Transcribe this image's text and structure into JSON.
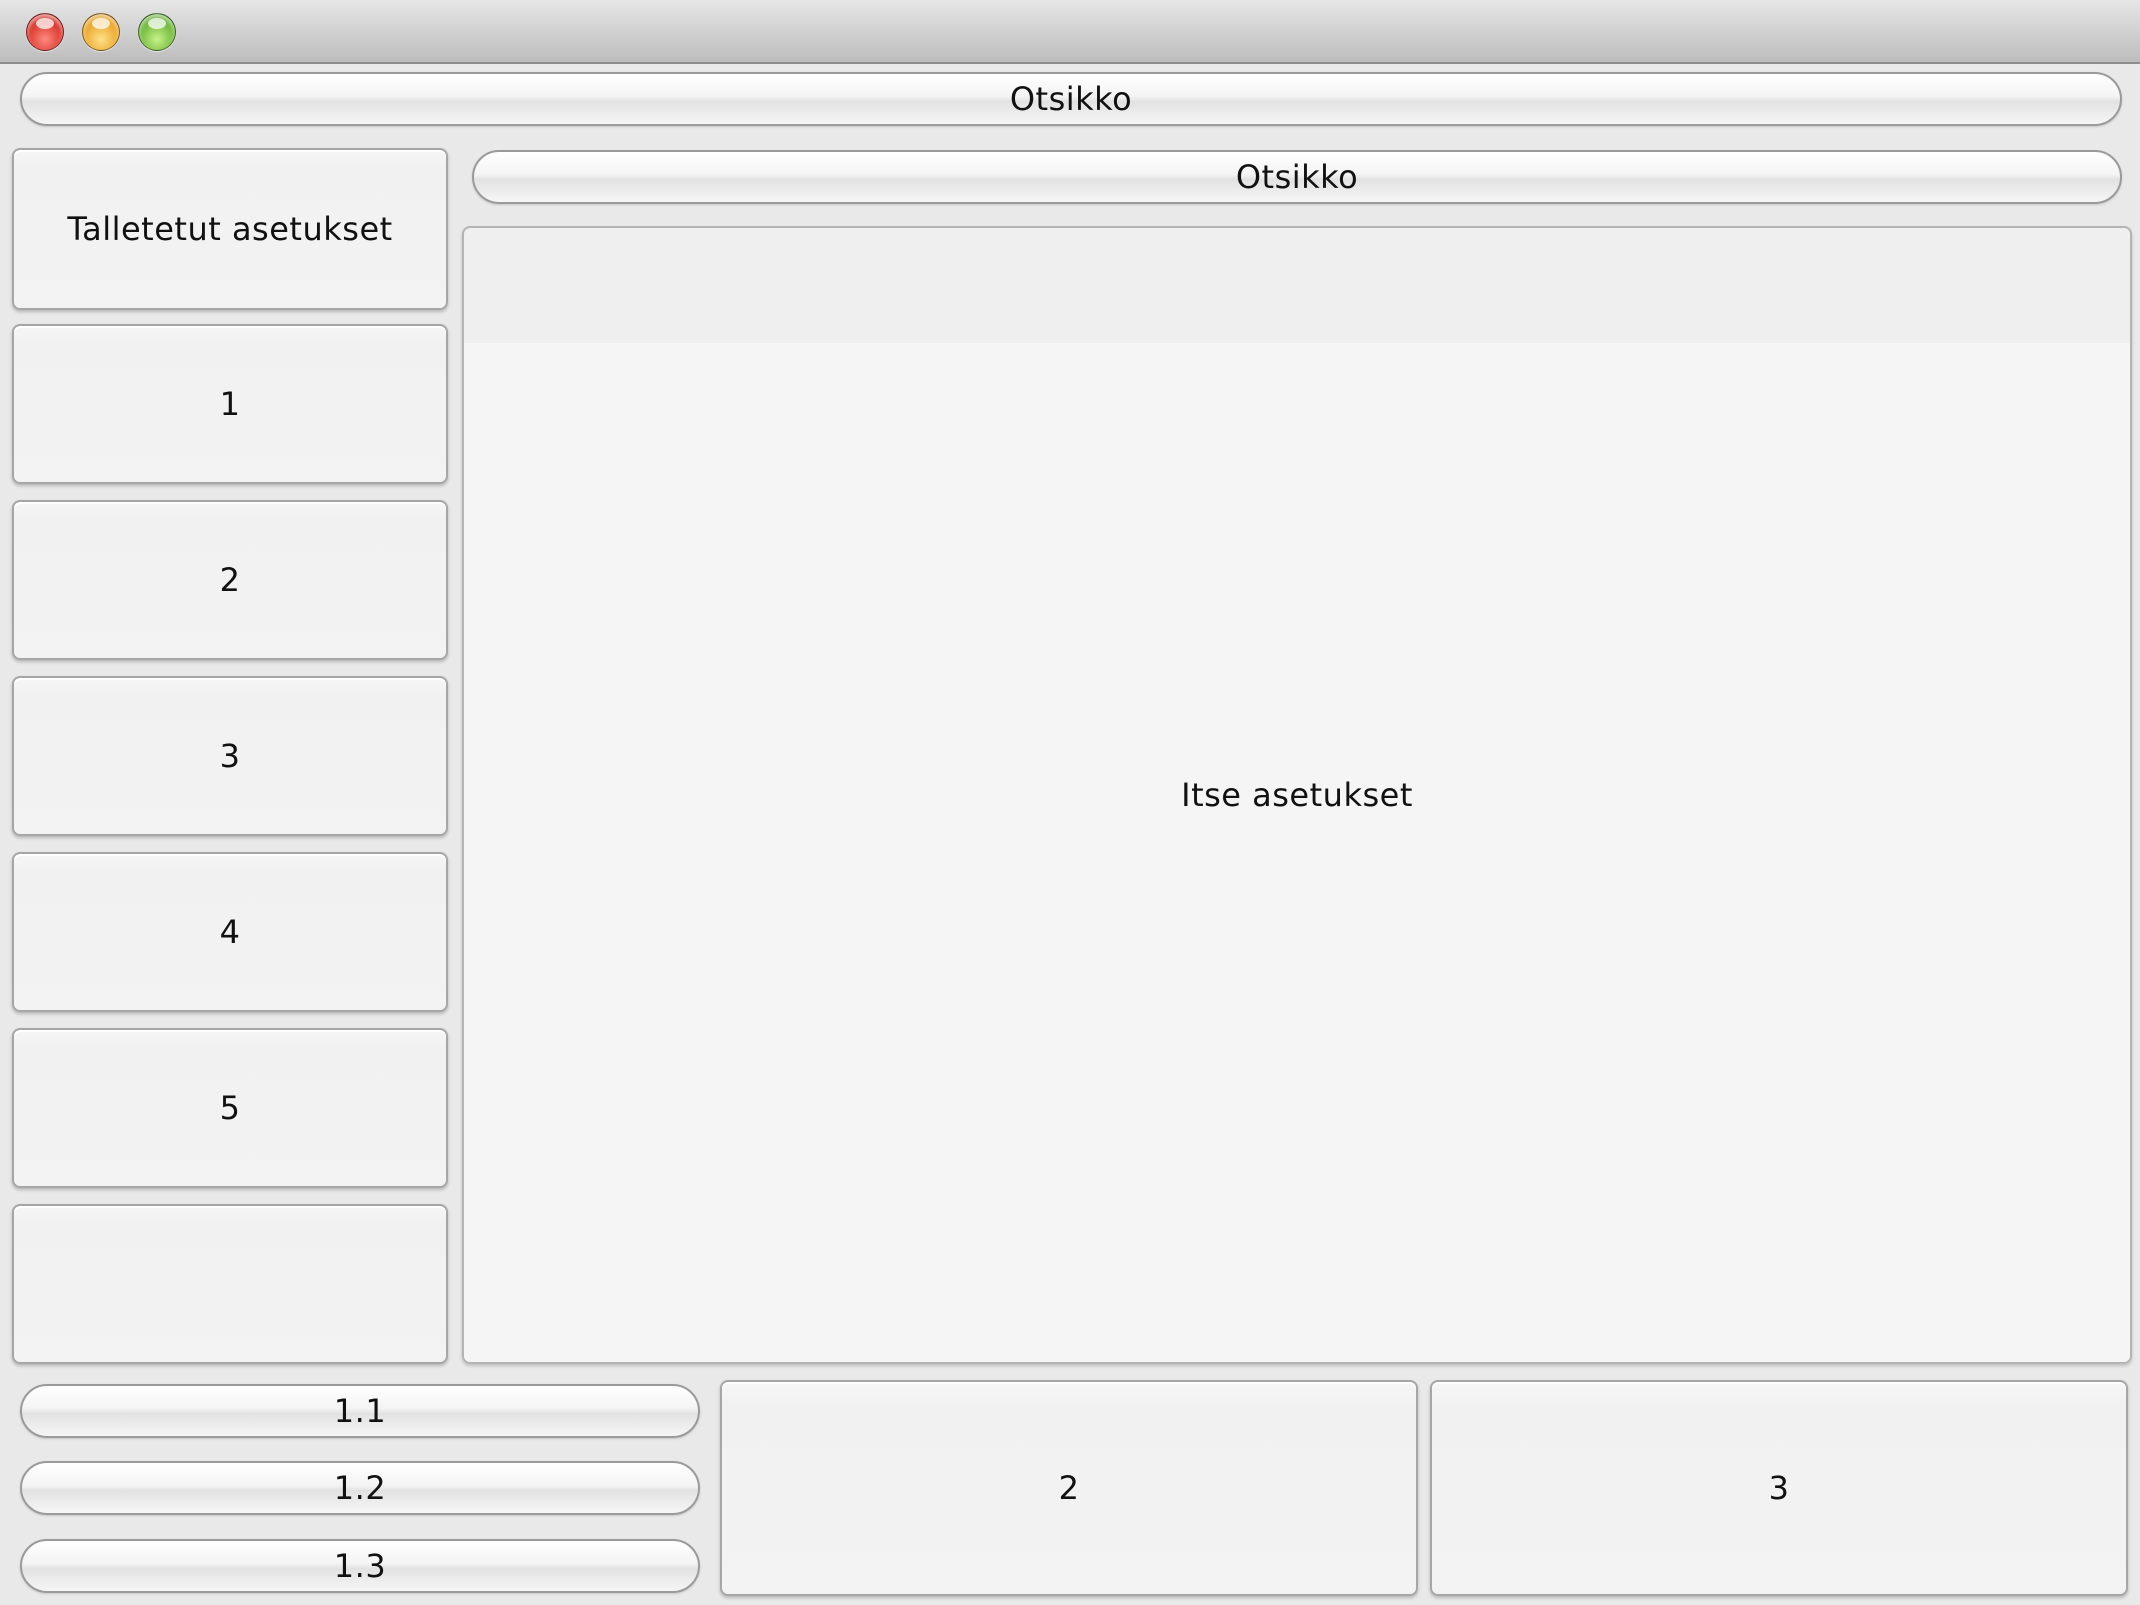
{
  "window": {
    "controls": [
      {
        "name": "close",
        "color": "#d0241b"
      },
      {
        "name": "minimize",
        "color": "#e59a16"
      },
      {
        "name": "zoom",
        "color": "#5cab2a"
      }
    ]
  },
  "header": {
    "top_title": "Otsikko",
    "main_title": "Otsikko"
  },
  "sidebar": {
    "saved_settings_label": "Talletetut asetukset",
    "items": [
      "1",
      "2",
      "3",
      "4",
      "5",
      ""
    ]
  },
  "main": {
    "panel_label": "Itse asetukset"
  },
  "footer": {
    "pill_buttons": [
      "1.1",
      "1.2",
      "1.3"
    ],
    "button_2": "2",
    "button_3": "3"
  }
}
